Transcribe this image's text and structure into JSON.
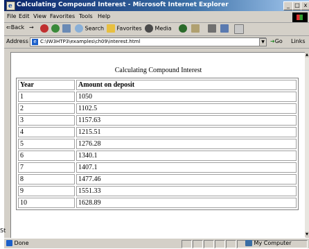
{
  "window": {
    "title": "Calculating Compound Interest - Microsoft Internet Explorer",
    "minimize": "_",
    "maximize": "□",
    "close": "x"
  },
  "menu": [
    "File",
    "Edit",
    "View",
    "Favorites",
    "Tools",
    "Help"
  ],
  "toolbar": {
    "back": "⇐Back",
    "forward": "→",
    "search": "Search",
    "favorites": "Favorites",
    "media": "Media"
  },
  "address": {
    "label": "Address",
    "url": "C:\\IW3HTP3\\examples\\ch09\\interest.html",
    "go": "Go",
    "links": "Links"
  },
  "page": {
    "caption": "Calculating Compound Interest",
    "headers": [
      "Year",
      "Amount on deposit"
    ],
    "rows": [
      [
        "1",
        "1050"
      ],
      [
        "2",
        "1102.5"
      ],
      [
        "3",
        "1157.63"
      ],
      [
        "4",
        "1215.51"
      ],
      [
        "5",
        "1276.28"
      ],
      [
        "6",
        "1340.1"
      ],
      [
        "7",
        "1407.1"
      ],
      [
        "8",
        "1477.46"
      ],
      [
        "9",
        "1551.33"
      ],
      [
        "10",
        "1628.89"
      ]
    ]
  },
  "status": {
    "text": "Done",
    "zone": "My Computer"
  },
  "stray_text": "St"
}
